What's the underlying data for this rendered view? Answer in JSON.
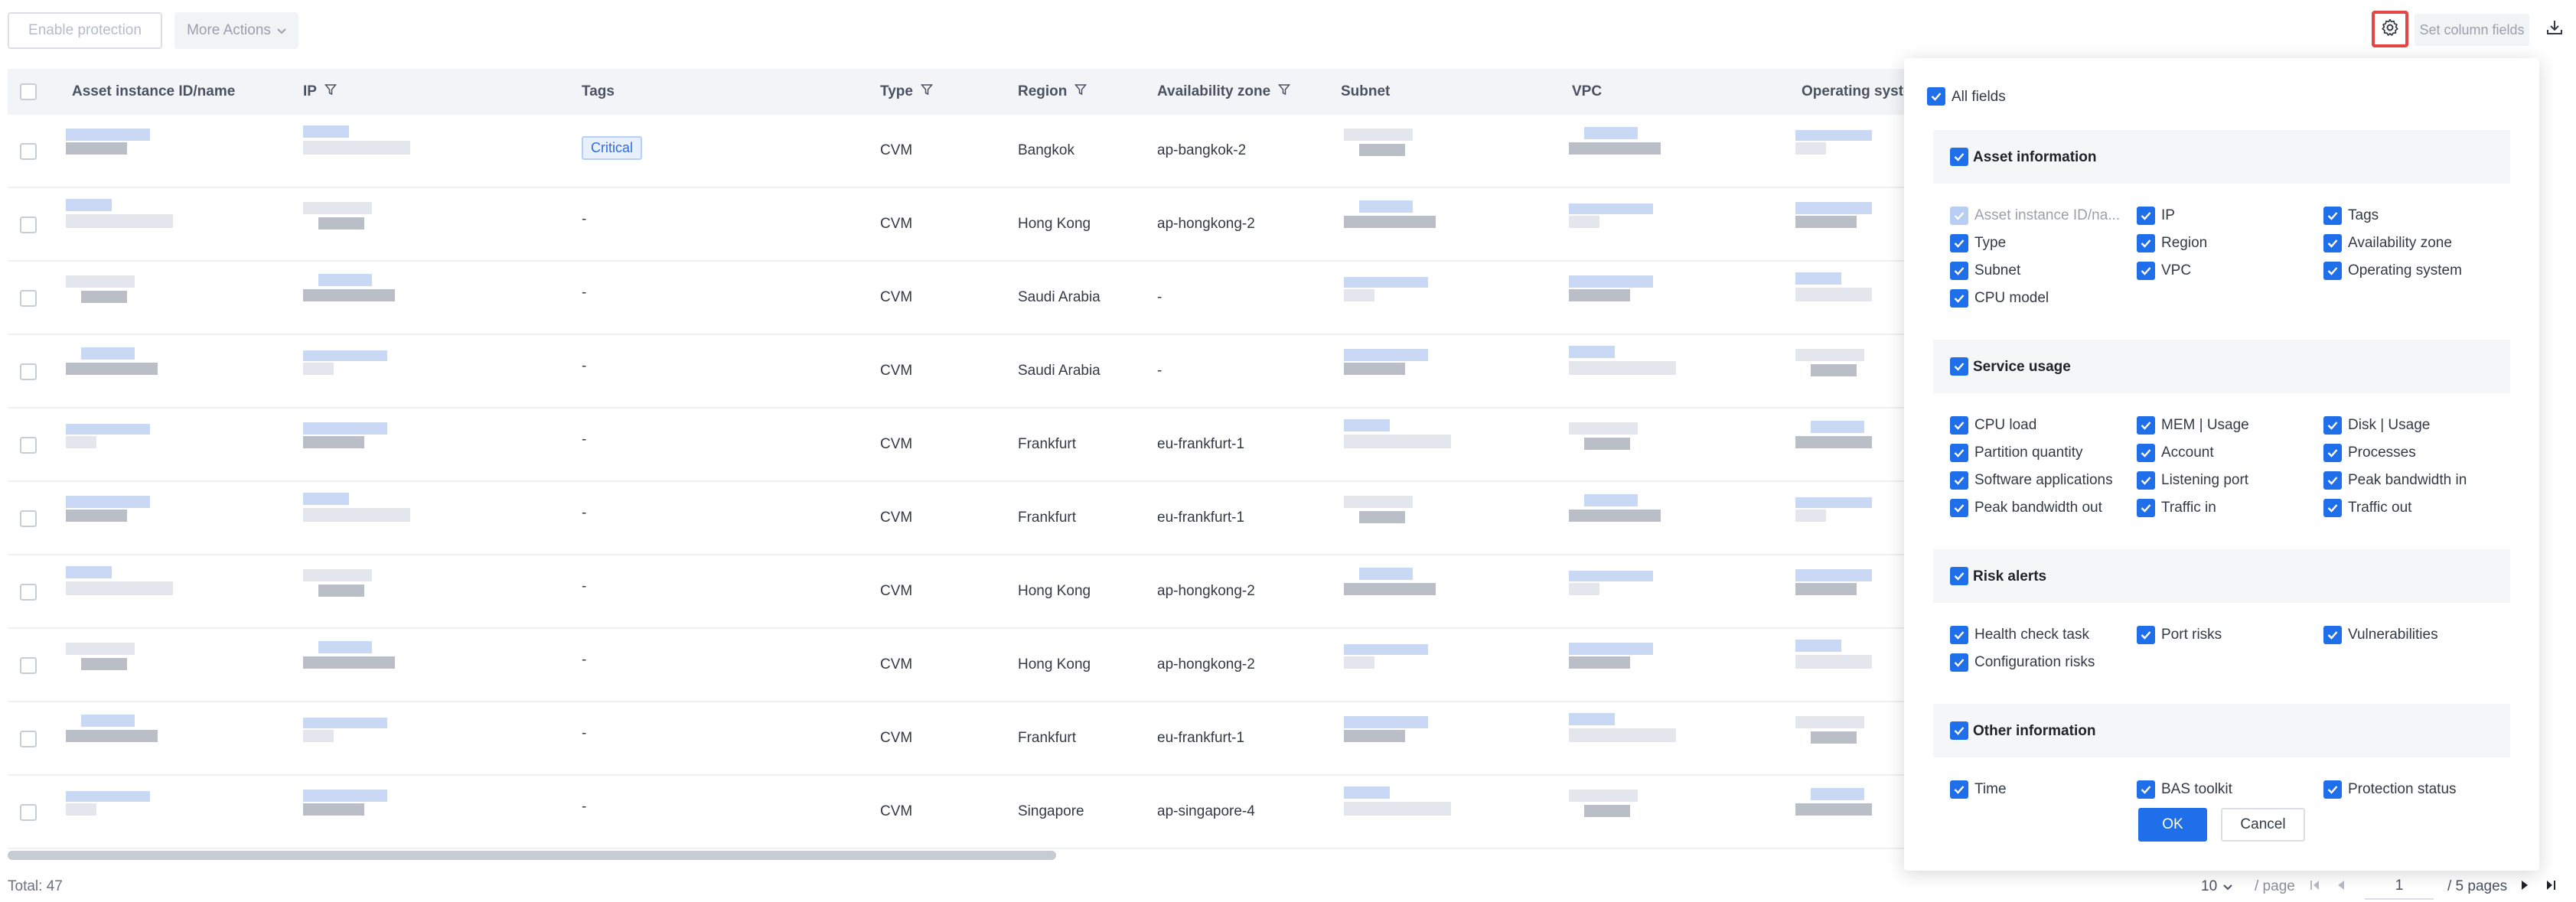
{
  "toolbar": {
    "enable_protection": "Enable protection",
    "more_actions": "More Actions",
    "set_column_fields": "Set column fields",
    "settings_icon": "gear-icon",
    "download_icon": "download-icon"
  },
  "table": {
    "columns": [
      {
        "label": "Asset instance ID/name",
        "filter": false
      },
      {
        "label": "IP",
        "filter": true
      },
      {
        "label": "Tags",
        "filter": false
      },
      {
        "label": "Type",
        "filter": true
      },
      {
        "label": "Region",
        "filter": true
      },
      {
        "label": "Availability zone",
        "filter": true
      },
      {
        "label": "Subnet",
        "filter": false
      },
      {
        "label": "VPC",
        "filter": false
      },
      {
        "label": "Operating syste",
        "filter": false
      }
    ],
    "rows": [
      {
        "tags": "Critical",
        "type": "CVM",
        "region": "Bangkok",
        "zone": "ap-bangkok-2"
      },
      {
        "tags": "-",
        "type": "CVM",
        "region": "Hong Kong",
        "zone": "ap-hongkong-2"
      },
      {
        "tags": "-",
        "type": "CVM",
        "region": "Saudi Arabia",
        "zone": "-"
      },
      {
        "tags": "-",
        "type": "CVM",
        "region": "Saudi Arabia",
        "zone": "-"
      },
      {
        "tags": "-",
        "type": "CVM",
        "region": "Frankfurt",
        "zone": "eu-frankfurt-1"
      },
      {
        "tags": "-",
        "type": "CVM",
        "region": "Frankfurt",
        "zone": "eu-frankfurt-1"
      },
      {
        "tags": "-",
        "type": "CVM",
        "region": "Hong Kong",
        "zone": "ap-hongkong-2"
      },
      {
        "tags": "-",
        "type": "CVM",
        "region": "Hong Kong",
        "zone": "ap-hongkong-2"
      },
      {
        "tags": "-",
        "type": "CVM",
        "region": "Frankfurt",
        "zone": "eu-frankfurt-1"
      },
      {
        "tags": "-",
        "type": "CVM",
        "region": "Singapore",
        "zone": "ap-singapore-4"
      }
    ]
  },
  "footer": {
    "total": "Total: 47",
    "page_size": "10",
    "per_page": "/ page",
    "current_page": "1",
    "total_pages": "/ 5 pages"
  },
  "panel": {
    "all_fields": "All fields",
    "sections": [
      {
        "title": "Asset information",
        "items": [
          {
            "label": "Asset instance ID/na...",
            "disabled": true
          },
          {
            "label": "IP"
          },
          {
            "label": "Tags"
          },
          {
            "label": "Type"
          },
          {
            "label": "Region"
          },
          {
            "label": "Availability zone"
          },
          {
            "label": "Subnet"
          },
          {
            "label": "VPC"
          },
          {
            "label": "Operating system"
          },
          {
            "label": "CPU model"
          }
        ]
      },
      {
        "title": "Service usage",
        "items": [
          {
            "label": "CPU load"
          },
          {
            "label": "MEM | Usage"
          },
          {
            "label": "Disk | Usage"
          },
          {
            "label": "Partition quantity"
          },
          {
            "label": "Account"
          },
          {
            "label": "Processes"
          },
          {
            "label": "Software applications"
          },
          {
            "label": "Listening port"
          },
          {
            "label": "Peak bandwidth in"
          },
          {
            "label": "Peak bandwidth out"
          },
          {
            "label": "Traffic in"
          },
          {
            "label": "Traffic out"
          }
        ]
      },
      {
        "title": "Risk alerts",
        "items": [
          {
            "label": "Health check task"
          },
          {
            "label": "Port risks"
          },
          {
            "label": "Vulnerabilities"
          },
          {
            "label": "Configuration risks"
          }
        ]
      },
      {
        "title": "Other information",
        "items": [
          {
            "label": "Time"
          },
          {
            "label": "BAS toolkit"
          },
          {
            "label": "Protection status"
          }
        ]
      }
    ],
    "ok": "OK",
    "cancel": "Cancel"
  },
  "colors": {
    "accent": "#1f6fea",
    "highlight_border": "#e54545",
    "tag_text": "#2f6ce5"
  }
}
